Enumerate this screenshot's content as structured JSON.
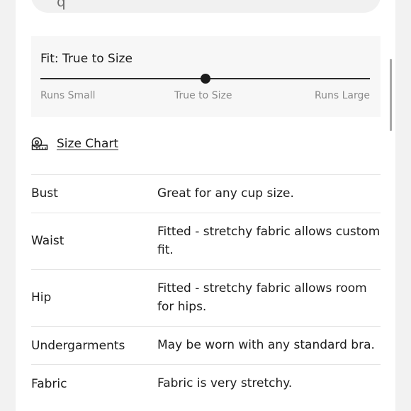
{
  "fit": {
    "title": "Fit: True to Size",
    "level": 0.5,
    "labels": {
      "left": "Runs Small",
      "middle": "True to Size",
      "right": "Runs Large"
    }
  },
  "size_chart": {
    "icon": "measuring-tape-icon",
    "label": "Size Chart"
  },
  "specs": [
    {
      "key": "Bust",
      "value": "Great for any cup size."
    },
    {
      "key": "Waist",
      "value": "Fitted - stretchy fabric allows custom fit."
    },
    {
      "key": "Hip",
      "value": "Fitted - stretchy fabric allows room for hips."
    },
    {
      "key": "Undergarments",
      "value": "May be worn with any standard bra."
    },
    {
      "key": "Fabric",
      "value": "Fabric is very stretchy."
    }
  ]
}
